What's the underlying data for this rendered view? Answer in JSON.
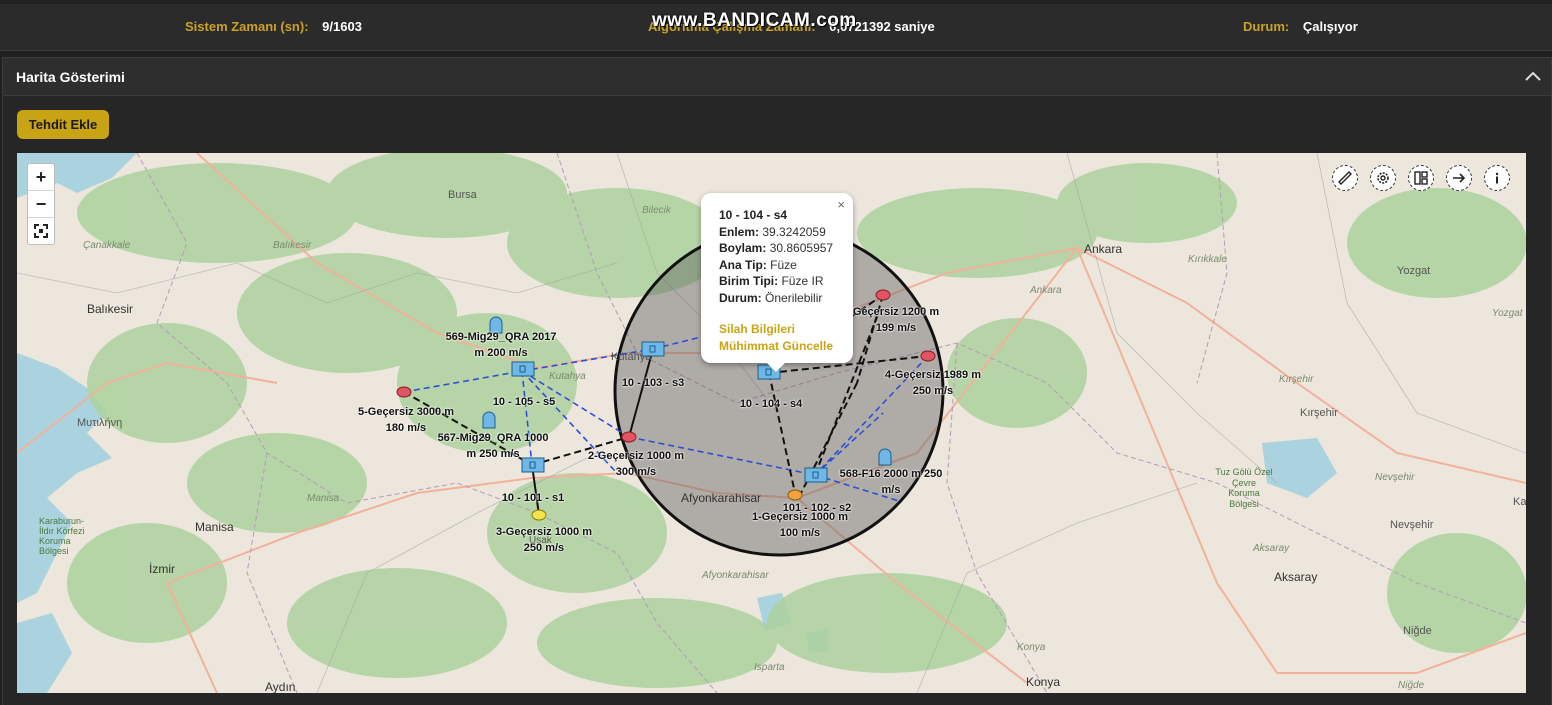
{
  "status": {
    "system_time_label": "Sistem Zamanı (sn):",
    "system_time_value": "9/1603",
    "algo_time_label": "Algoritma Çalışma Zamanı:",
    "algo_time_value": "0,0721392 saniye",
    "state_label": "Durum:",
    "state_value": "Çalışıyor"
  },
  "watermark": "www.BANDICAM.com",
  "panel": {
    "title": "Harita Gösterimi"
  },
  "actions": {
    "add_threat": "Tehdit Ekle"
  },
  "map": {
    "zoom_in": "+",
    "zoom_out": "−",
    "places": {
      "bursa": "Bursa",
      "bilecik": "Bilecik",
      "canakkale": "Çanakkale",
      "balikesir_small": "Balıkesir",
      "balikesir": "Balıkesir",
      "kutahya": "Kütahya",
      "kutahya_small": "Kutahya",
      "mytilene": "Μυτιλήνη",
      "manisa": "Manisa",
      "manisa_small": "Manisa",
      "izmir": "İzmir",
      "karaburun": "Karaburun-İldır Körfezi Koruma Bölgesi",
      "usak": "Uşak",
      "afyon": "Afyonkarahisar",
      "afyon_small": "Afyonkarahisar",
      "isparta": "Isparta",
      "aydin": "Aydın",
      "ankara": "Ankara",
      "ankara_small": "Ankara",
      "kirikkale": "Kırıkkale",
      "yozgat": "Yozgat",
      "yozgat_small": "Yozgat",
      "kirsehir_small": "Kırşehir",
      "kirsehir": "Kırşehir",
      "tuz_golu": "Tuz Gölü Özel Çevre Koruma Bölgesi",
      "nevsehir_small": "Nevşehir",
      "nevsehir": "Nevşehir",
      "aksaray_small": "Aksaray",
      "aksaray": "Aksaray",
      "konya": "Konya",
      "konya_small": "Konya",
      "nigde": "Niğde",
      "nigde_small": "Niğde",
      "kayseri": "Ka"
    },
    "labels": {
      "t569": [
        "569-Mig29_QRA 2017",
        "m 200 m/s"
      ],
      "s5": [
        "10 - 105 - s5"
      ],
      "t5": [
        "5-Geçersiz 3000 m",
        "180 m/s"
      ],
      "t567": [
        "567-Mig29_QRA 1000",
        "m 250 m/s"
      ],
      "s1": [
        "10 - 101 - s1"
      ],
      "t3": [
        "3-Geçersiz 1000 m",
        "250 m/s"
      ],
      "s3": [
        "10 - 103 - s3"
      ],
      "t2": [
        "2-Geçersiz 1000 m",
        "300 m/s"
      ],
      "s4": [
        "10 - 104 - s4"
      ],
      "t4": [
        "4-Geçersiz 1989 m",
        "250 m/s"
      ],
      "tg": [
        "Geçersiz 1200 m",
        "199 m/s"
      ],
      "t568": [
        "568-F16 2000 m 250",
        "m/s"
      ],
      "s2": [
        "101 - 102 - s2"
      ],
      "t1": [
        "1-Geçersiz 1000 m",
        "100 m/s"
      ]
    },
    "popup": {
      "title": "10 - 104 - s4",
      "lat_label": "Enlem:",
      "lat_value": "39.3242059",
      "lon_label": "Boylam:",
      "lon_value": "30.8605957",
      "main_type_label": "Ana Tip:",
      "main_type_value": "Füze",
      "unit_type_label": "Birim Tipi:",
      "unit_type_value": "Füze IR",
      "status_label": "Durum:",
      "status_value": "Önerilebilir",
      "weapon_info": "Silah Bilgileri",
      "ammo_update": "Mühimmat Güncelle",
      "close": "×"
    }
  },
  "colors": {
    "accent": "#c8a414",
    "sensor_blue": "#6fb7e6",
    "threat_red": "#e05561",
    "link_blue": "#2a4fd8"
  }
}
